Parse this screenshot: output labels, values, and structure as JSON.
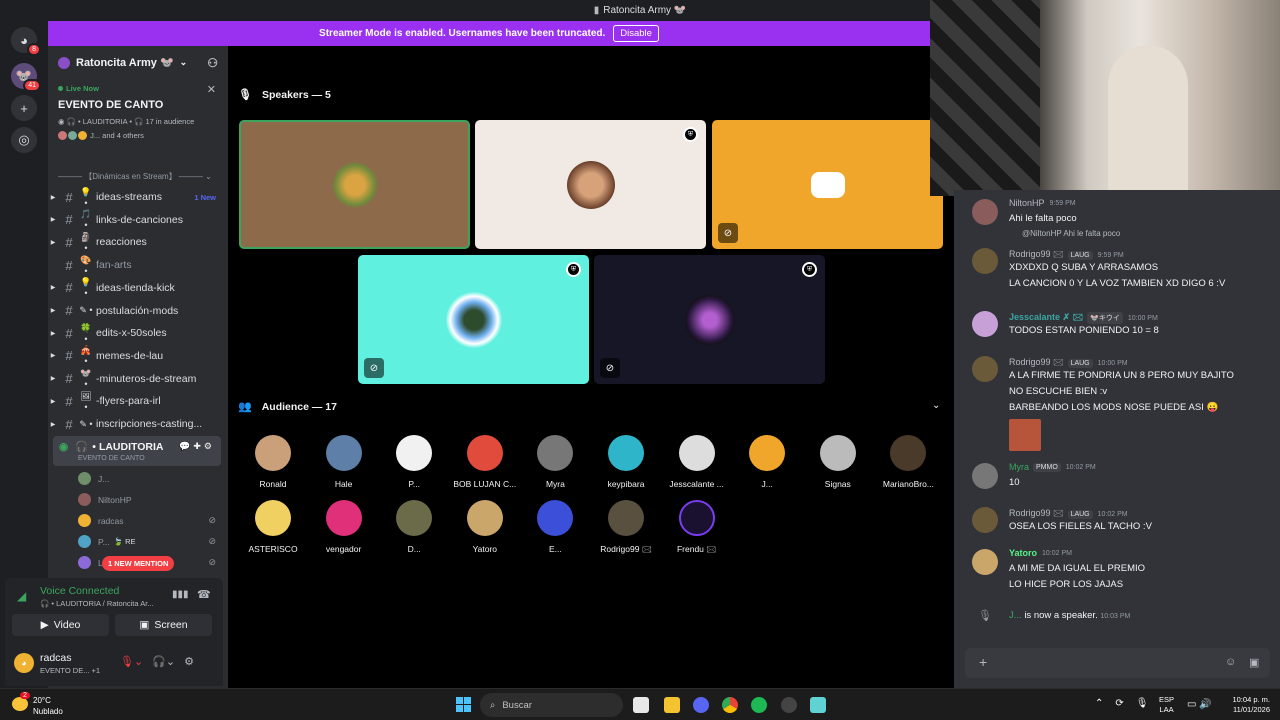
{
  "window": {
    "title": "Ratoncita Army 🐭"
  },
  "banner": {
    "text": "Streamer Mode is enabled. Usernames have been truncated.",
    "button": "Disable"
  },
  "rail": {
    "badges": [
      "8",
      "41"
    ]
  },
  "guild": {
    "name": "Ratoncita Army 🐭"
  },
  "live": {
    "label": "Live Now",
    "event": "EVENTO DE CANTO",
    "host": "LAUDITORIA",
    "audience": "17 in audience",
    "others": "J... and 4 others"
  },
  "category": "——— 【Dinámicas en Stream】 ———",
  "channels": [
    {
      "emoji": "💡",
      "name": "ideas-streams",
      "new": "1 New",
      "arrow": true
    },
    {
      "emoji": "🎵",
      "name": "links-de-canciones",
      "arrow": true
    },
    {
      "emoji": "🗿",
      "name": "reacciones",
      "arrow": true
    },
    {
      "emoji": "🎨",
      "name": "fan-arts",
      "arrow": false,
      "dim": true
    },
    {
      "emoji": "💡",
      "name": "ideas-tienda-kick",
      "arrow": true
    },
    {
      "emoji": "✎",
      "name": "postulación-mods",
      "arrow": true
    },
    {
      "emoji": "🍀",
      "name": "edits-x-50soles",
      "arrow": true
    },
    {
      "emoji": "🎪",
      "name": "memes-de-lau",
      "arrow": true
    },
    {
      "emoji": "🐭",
      "name": "-minuteros-de-stream",
      "arrow": true
    },
    {
      "emoji": "🖼",
      "name": "-flyers-para-irl",
      "arrow": true
    },
    {
      "emoji": "✎",
      "name": "inscripciones-casting...",
      "arrow": true
    }
  ],
  "voice_channel": {
    "name": "LAUDITORIA",
    "sub": "EVENTO DE CANTO"
  },
  "voice_users": [
    {
      "name": "J...",
      "color": "#6f8f6a"
    },
    {
      "name": "NiltonHP",
      "color": "#8a5c5c"
    },
    {
      "name": "radcas",
      "color": "#f0b232"
    },
    {
      "name": "P...",
      "tag": "🍃 RE",
      "color": "#4fa3c7"
    },
    {
      "name": "L...",
      "color": "#8c6bd8"
    }
  ],
  "new_mention": "1 NEW MENTION",
  "voice_conn": {
    "status": "Voice Connected",
    "location": "LAUDITORIA / Ratoncita Ar...",
    "video": "Video",
    "screen": "Screen"
  },
  "user": {
    "name": "radcas",
    "status": "EVENTO DE... +1"
  },
  "speakers": {
    "label": "Speakers — 5"
  },
  "audience": {
    "label": "Audience — 17",
    "members": [
      "Ronald",
      "Hale",
      "P...",
      "BOB LUJAN C...",
      "Myra",
      "keypibara",
      "Jesscalante ...",
      "J...",
      "Signas",
      "MarianoBro...",
      "ASTERISCO",
      "vengador",
      "D...",
      "Yatoro",
      "E...",
      "Rodrigo99 🖂",
      "Frendu 🖂"
    ]
  },
  "chat": {
    "messages": [
      {
        "user": "NiltonHP",
        "time": "9:59 PM",
        "text": "Ahi le falta poco"
      },
      {
        "reply": "@NiltonHP Ahi le falta poco",
        "user": "Rodrigo99 🖂",
        "tag": "LAUG",
        "time": "9:59 PM",
        "lines": [
          "XDXDXD Q SUBA Y ARRASAMOS",
          "LA CANCION 0 Y LA VOZ TAMBIEN XD DIGO 6 :V"
        ]
      },
      {
        "user": "Jesscalante ✗ 🖂",
        "tag": "🐭キウイ",
        "time": "10:00 PM",
        "text": "TODOS ESTAN PONIENDO 10 = 8"
      },
      {
        "user": "Rodrigo99 🖂",
        "tag": "LAUG",
        "time": "10:00 PM",
        "lines": [
          "A LA FIRME TE PONDRIA UN 8 PERO MUY BAJITO",
          "NO ESCUCHE BIEN :v",
          "BARBEANDO LOS MODS NOSE PUEDE ASI 😛"
        ]
      },
      {
        "user": "Myra",
        "tag": "PMMO",
        "time": "10:02 PM",
        "text": "10"
      },
      {
        "user": "Rodrigo99 🖂",
        "tag": "LAUG",
        "time": "10:02 PM",
        "text": "OSEA LOS FIELES AL TACHO :V"
      },
      {
        "user": "Yatoro",
        "time": "10:02 PM",
        "lines": [
          "A MI ME DA IGUAL EL PREMIO",
          "LO HICE POR LOS JAJAS"
        ]
      },
      {
        "system_user": "J...",
        "system_text": "is now a speaker.",
        "time": "10:03 PM"
      }
    ]
  },
  "taskbar": {
    "weather_temp": "20°C",
    "weather_desc": "Nublado",
    "weather_badge": "2",
    "search": "Buscar",
    "lang1": "ESP",
    "lang2": "LAA",
    "time": "10:04 p. m.",
    "date": "11/01/2026"
  }
}
